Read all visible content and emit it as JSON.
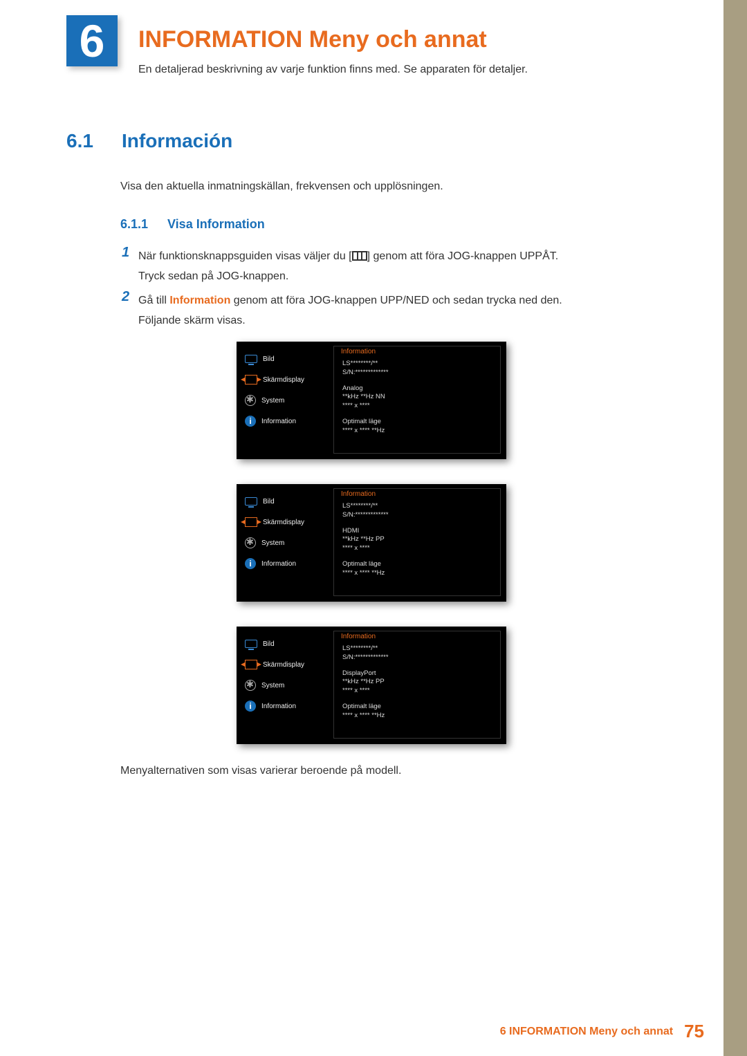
{
  "chapter": {
    "number": "6",
    "title": "INFORMATION Meny och annat",
    "subtitle": "En detaljerad beskrivning av varje funktion finns med. Se apparaten för detaljer."
  },
  "section": {
    "number": "6.1",
    "title": "Información",
    "intro": "Visa den aktuella inmatningskällan, frekvensen och upplösningen."
  },
  "subsection": {
    "number": "6.1.1",
    "title": "Visa Information"
  },
  "steps": {
    "s1": {
      "num": "1",
      "pre": "När funktionsknappsguiden visas väljer du [",
      "post": "] genom att föra JOG-knappen UPPÅT.",
      "line2": "Tryck sedan på JOG-knappen."
    },
    "s2": {
      "num": "2",
      "pre": "Gå till ",
      "emph": "Information",
      "post": " genom att föra JOG-knappen UPP/NED och sedan trycka ned den.",
      "line2": "Följande skärm visas."
    }
  },
  "osd_menu": {
    "items": [
      "Bild",
      "Skärmdisplay",
      "System",
      "Information"
    ],
    "panel_title": "Information"
  },
  "panels": [
    {
      "model": "LS********/**",
      "serial": "S/N:*************",
      "source": "Analog",
      "freq": "**kHz **Hz NN",
      "res": "**** x ****",
      "opt_label": "Optimalt läge",
      "opt_val": "**** x **** **Hz"
    },
    {
      "model": "LS********/**",
      "serial": "S/N:*************",
      "source": "HDMI",
      "freq": "**kHz **Hz PP",
      "res": "**** x ****",
      "opt_label": "Optimalt läge",
      "opt_val": "**** x **** **Hz"
    },
    {
      "model": "LS********/**",
      "serial": "S/N:*************",
      "source": "DisplayPort",
      "freq": "**kHz **Hz PP",
      "res": "**** x ****",
      "opt_label": "Optimalt läge",
      "opt_val": "**** x **** **Hz"
    }
  ],
  "footnote": "Menyalternativen som visas varierar beroende på modell.",
  "footer": {
    "text": "6 INFORMATION Meny och annat",
    "page": "75"
  }
}
